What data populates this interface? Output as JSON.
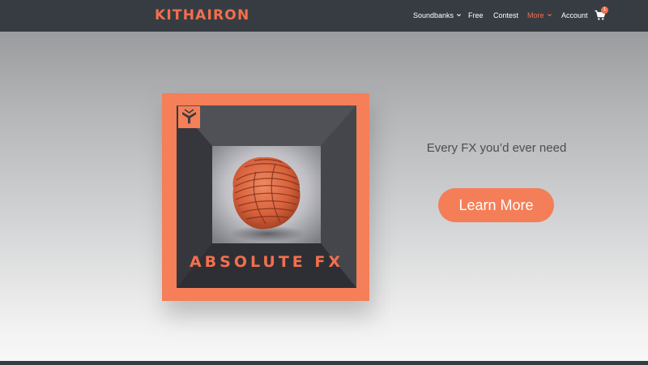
{
  "header": {
    "logo": "KITHAIRON",
    "nav": [
      {
        "label": "Soundbanks",
        "has_dropdown": true
      },
      {
        "label": "Free",
        "has_dropdown": false
      },
      {
        "label": "Contest",
        "has_dropdown": false
      },
      {
        "label": "More",
        "has_dropdown": true,
        "active": true
      },
      {
        "label": "Account",
        "has_dropdown": false
      }
    ],
    "cart": {
      "icon": "cart-icon",
      "count": "1"
    }
  },
  "hero": {
    "cover_title": "ABSOLUTE FX",
    "badge_icon": "kithairon-mark-icon",
    "tagline": "Every FX you’d ever need",
    "cta_label": "Learn More"
  },
  "colors": {
    "accent": "#f36f4d",
    "header_bg": "#373c42",
    "cover_bg": "#f47f58",
    "cta_bg": "#f47e58",
    "tagline_text": "#4b4e52"
  }
}
